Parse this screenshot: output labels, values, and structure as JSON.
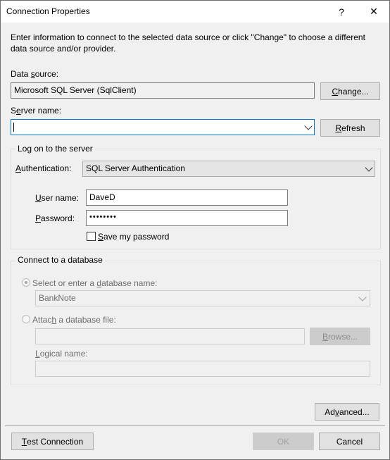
{
  "window": {
    "title": "Connection Properties",
    "help": "?",
    "close": "✕"
  },
  "intro": {
    "line1": "Enter information to connect to the selected data source or click \"Change\" to choose a different",
    "line2": "data source and/or provider."
  },
  "data_source": {
    "label_pre": "Data ",
    "label_u": "s",
    "label_post": "ource:",
    "value": "Microsoft SQL Server (SqlClient)",
    "change_pre": "",
    "change_u": "C",
    "change_post": "hange..."
  },
  "server": {
    "label_pre": "S",
    "label_u": "e",
    "label_post": "rver name:",
    "value": "",
    "refresh_pre": "",
    "refresh_u": "R",
    "refresh_post": "efresh"
  },
  "logon": {
    "group_title": "Log on to the server",
    "auth_label_pre": "",
    "auth_label_u": "A",
    "auth_label_post": "uthentication:",
    "auth_value": "SQL Server Authentication",
    "user_label_pre": "",
    "user_label_u": "U",
    "user_label_post": "ser name:",
    "user_value": "DaveD",
    "pass_label_pre": "",
    "pass_label_u": "P",
    "pass_label_post": "assword:",
    "pass_value": "••••••••",
    "save_pre": "",
    "save_u": "S",
    "save_post": "ave my password"
  },
  "database": {
    "group_title": "Connect to a database",
    "select_pre": "Select or enter a ",
    "select_u": "d",
    "select_post": "atabase name:",
    "db_value": "BankNote",
    "attach_pre": "Attac",
    "attach_u": "h",
    "attach_post": " a database file:",
    "browse_pre": "",
    "browse_u": "B",
    "browse_post": "rowse...",
    "logical_pre": "",
    "logical_u": "L",
    "logical_post": "ogical name:"
  },
  "footer": {
    "advanced_pre": "Ad",
    "advanced_u": "v",
    "advanced_post": "anced...",
    "test_pre": "",
    "test_u": "T",
    "test_post": "est Connection",
    "ok": "OK",
    "cancel": "Cancel"
  }
}
